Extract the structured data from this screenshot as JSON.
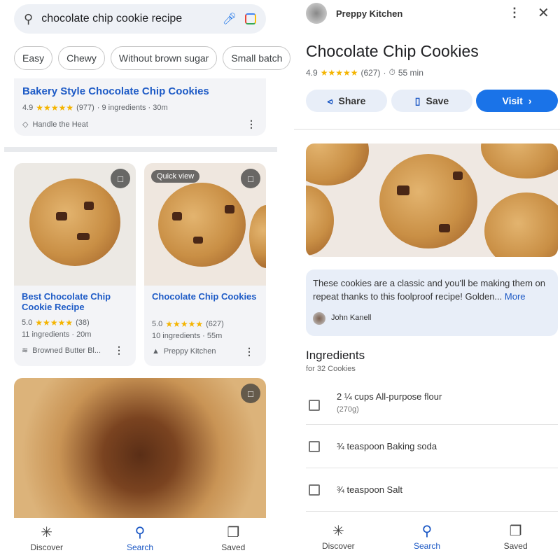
{
  "search": {
    "query": "chocolate chip cookie recipe",
    "icons": [
      "search-icon",
      "mic-icon",
      "lens-icon"
    ]
  },
  "chips": [
    "Easy",
    "Chewy",
    "Without brown sugar",
    "Small batch"
  ],
  "results": [
    {
      "title": "Bakery Style Chocolate Chip Cookies",
      "rating": "4.9",
      "count": "(977)",
      "details": "· 9 ingredients · 30m",
      "source": "Handle the Heat"
    },
    {
      "title": "Best Chocolate Chip Cookie Recipe",
      "rating": "5.0",
      "count": "(38)",
      "details": "11 ingredients · 20m",
      "source": "Browned Butter Bl..."
    },
    {
      "title": "Chocolate Chip Cookies",
      "rating": "5.0",
      "count": "(627)",
      "details": "10 ingredients · 55m",
      "source": "Preppy Kitchen",
      "badge": "Quick view"
    }
  ],
  "nav": [
    {
      "label": "Discover",
      "icon": "asterisk-icon"
    },
    {
      "label": "Search",
      "icon": "search-icon"
    },
    {
      "label": "Saved",
      "icon": "saved-icon"
    }
  ],
  "detail": {
    "source": "Preppy Kitchen",
    "title": "Chocolate Chip Cookies",
    "rating": "4.9",
    "count": "(627)",
    "time": "55 min",
    "share": "Share",
    "save": "Save",
    "visit": "Visit",
    "description": "These cookies are a classic and you'll be making them on repeat thanks to this foolproof recipe! Golden...",
    "more": "More",
    "author": "John Kanell",
    "ingredients_title": "Ingredients",
    "servings": "for 32 Cookies",
    "ingredients": [
      {
        "name": "2 ¼ cups All-purpose flour",
        "note": "(270g)"
      },
      {
        "name": "¾ teaspoon Baking soda"
      },
      {
        "name": "¾ teaspoon Salt"
      }
    ]
  },
  "stars": "★★★★★",
  "colors": {
    "accent": "#1a73e8",
    "link": "#1a57c4",
    "star": "#f4b400"
  }
}
